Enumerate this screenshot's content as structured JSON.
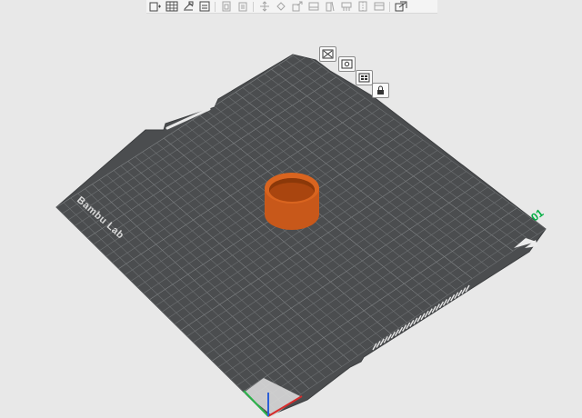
{
  "toolbar": {
    "buttons": [
      {
        "icon": "add-object-icon",
        "enabled": true
      },
      {
        "icon": "arrange-grid-icon",
        "enabled": true
      },
      {
        "icon": "orient-icon",
        "enabled": true
      },
      {
        "icon": "add-plate-icon",
        "enabled": true
      },
      {
        "icon": "copy-icon",
        "enabled": false
      },
      {
        "icon": "delete-icon",
        "enabled": false
      },
      {
        "icon": "move-icon",
        "enabled": false
      },
      {
        "icon": "rotate-icon",
        "enabled": false
      },
      {
        "icon": "scale-icon",
        "enabled": false
      },
      {
        "icon": "lay-on-face-icon",
        "enabled": false
      },
      {
        "icon": "cut-icon",
        "enabled": false
      },
      {
        "icon": "support-paint-icon",
        "enabled": false
      },
      {
        "icon": "seam-paint-icon",
        "enabled": false
      },
      {
        "icon": "measure-icon",
        "enabled": false
      },
      {
        "icon": "assembly-icon",
        "enabled": true
      }
    ]
  },
  "plate": {
    "brand_text": "Bambu Lab",
    "plate_number": "01",
    "accent_color": "#00ae42",
    "plate_color": "#4b4d4f",
    "grid_color": "#6e7173",
    "object_color": "#c8581a",
    "plate_tools": [
      {
        "icon": "close-plate-icon"
      },
      {
        "icon": "plate-settings-icon"
      },
      {
        "icon": "arrange-plate-icon"
      },
      {
        "icon": "lock-plate-icon"
      }
    ]
  },
  "axes": {
    "x_color": "#d62b2b",
    "y_color": "#2bb34a",
    "z_color": "#2b5fd6"
  }
}
